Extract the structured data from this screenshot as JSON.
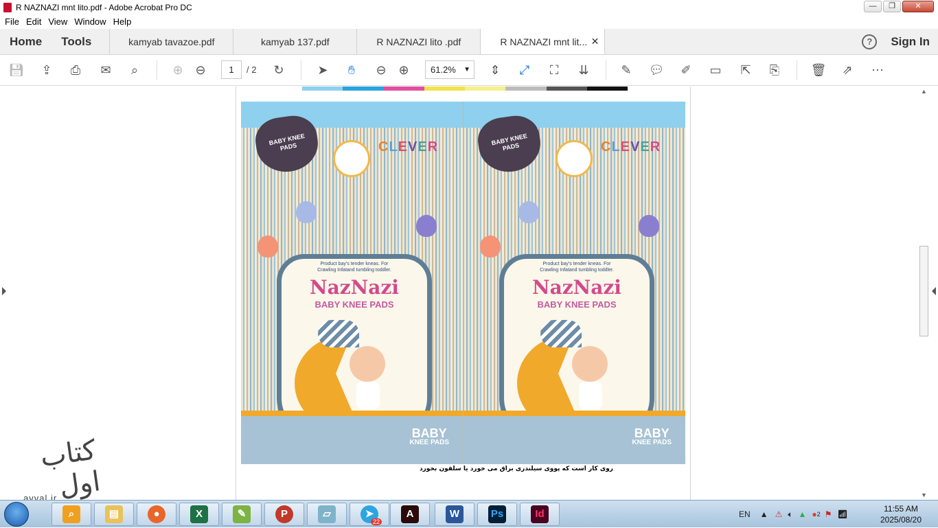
{
  "window": {
    "title": "R NAZNAZI mnt lito.pdf - Adobe Acrobat Pro DC"
  },
  "menu": [
    "File",
    "Edit",
    "View",
    "Window",
    "Help"
  ],
  "nav": {
    "home": "Home",
    "tools": "Tools"
  },
  "tabs": [
    {
      "label": "kamyab tavazoe.pdf"
    },
    {
      "label": "kamyab 137.pdf"
    },
    {
      "label": "R NAZNAZI  lito .pdf"
    },
    {
      "label": "R NAZNAZI mnt lit..."
    }
  ],
  "header_right": {
    "help": "?",
    "signin": "Sign In"
  },
  "toolbar": {
    "page_current": "1",
    "page_total": "/ 2",
    "zoom": "61.2%"
  },
  "document": {
    "heart_label": "BABY KNEE PADS",
    "brand_top": "CLEVER",
    "tagline": "Product bay's tender kneas. For Crawling Infatand tumbling toddler.",
    "brand": "NazNazi",
    "subtitle": "BABY KNEE PADS",
    "bottom_big": "BABY",
    "bottom_small": "KNEE PADS",
    "caption": "روی کار است که پووی سیلندری براق می خورد یا سلفون بخورد"
  },
  "watermark": {
    "logo": "کتاب اول",
    "site": "avval.ir"
  },
  "taskbar": {
    "language": "EN",
    "telegram_badge": "22",
    "tray_badge": "2",
    "time": "11:55 AM",
    "date": "2025/08/20"
  },
  "colors": {
    "accent_blue": "#1473e6",
    "brand_pink": "#d24a8c",
    "moon_orange": "#f0a92b",
    "frame_blue": "#5f7e96"
  }
}
